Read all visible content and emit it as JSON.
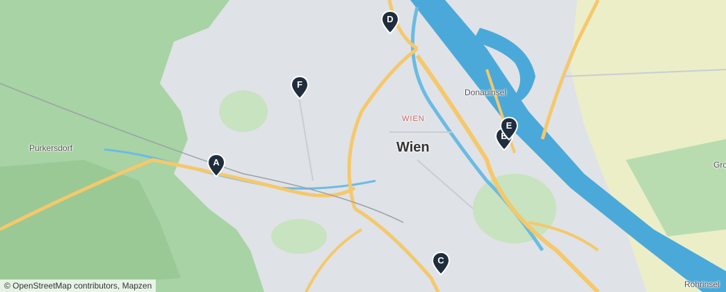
{
  "map": {
    "labels": {
      "purkersdorf": "Purkersdorf",
      "wien": "Wien",
      "wien_small": "WIEN",
      "donauinsel": "Donauinsel",
      "gro": "Gro",
      "rohrinsel": "Rohrinsel"
    },
    "markers": [
      {
        "letter": "A"
      },
      {
        "letter": "B"
      },
      {
        "letter": "C"
      },
      {
        "letter": "D"
      },
      {
        "letter": "E"
      },
      {
        "letter": "F"
      }
    ],
    "attribution": "© OpenStreetMap contributors, Mapzen",
    "colors": {
      "forest": "#9ccc9c",
      "urban": "#dfe2e7",
      "water": "#4aa9d9",
      "road": "#f5c86a",
      "marker": "#1f2d3d"
    }
  }
}
